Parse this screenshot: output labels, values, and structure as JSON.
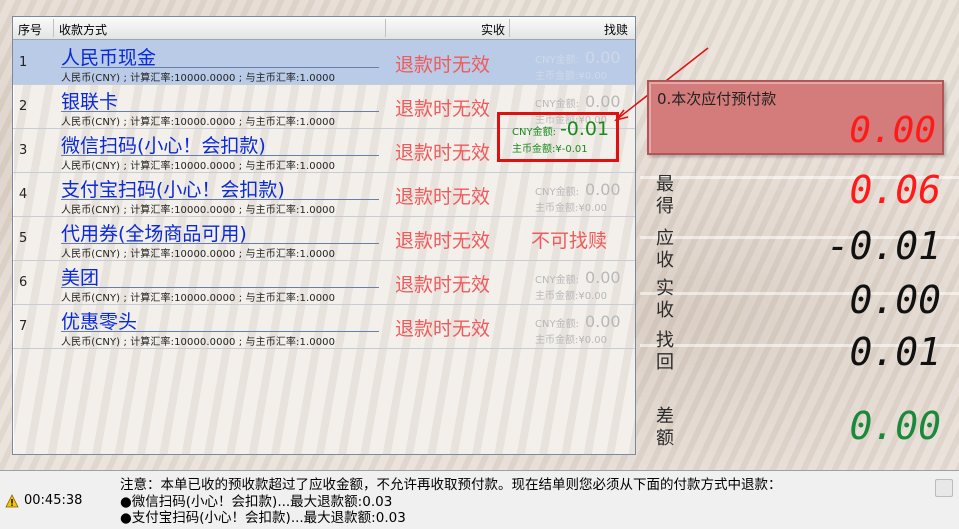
{
  "table": {
    "headers": {
      "index": "序号",
      "method": "收款方式",
      "received": "实收",
      "change": "找赎"
    },
    "rows": [
      {
        "index": "1",
        "name": "人民币现金",
        "sub": "人民币(CNY) ; 计算汇率:10000.0000 ; 与主币汇率:1.0000",
        "received": "退款时无效",
        "cny_label": "CNY金额:",
        "cny_value": "0.00",
        "main_label": "主币金额:",
        "main_value": "¥0.00"
      },
      {
        "index": "2",
        "name": "银联卡",
        "sub": "人民币(CNY) ; 计算汇率:10000.0000 ; 与主币汇率:1.0000",
        "received": "退款时无效",
        "cny_label": "CNY金额:",
        "cny_value": "0.00",
        "main_label": "主币金额:",
        "main_value": "¥0.00"
      },
      {
        "index": "3",
        "name": "微信扫码(小心！会扣款)",
        "sub": "人民币(CNY) ; 计算汇率:10000.0000 ; 与主币汇率:1.0000",
        "received": "退款时无效",
        "cny_label": "CNY金额:",
        "cny_value": "-0.01",
        "main_label": "主币金额:",
        "main_value": "¥-0.01"
      },
      {
        "index": "4",
        "name": "支付宝扫码(小心！会扣款)",
        "sub": "人民币(CNY) ; 计算汇率:10000.0000 ; 与主币汇率:1.0000",
        "received": "退款时无效",
        "cny_label": "CNY金额:",
        "cny_value": "0.00",
        "main_label": "主币金额:",
        "main_value": "¥0.00"
      },
      {
        "index": "5",
        "name": "代用券(全场商品可用)",
        "sub": "人民币(CNY) ; 计算汇率:10000.0000 ; 与主币汇率:1.0000",
        "received": "退款时无效",
        "no_change": "不可找赎"
      },
      {
        "index": "6",
        "name": "美团",
        "sub": "人民币(CNY) ; 计算汇率:10000.0000 ; 与主币汇率:1.0000",
        "received": "退款时无效",
        "cny_label": "CNY金额:",
        "cny_value": "0.00",
        "main_label": "主币金额:",
        "main_value": "¥0.00"
      },
      {
        "index": "7",
        "name": "优惠零头",
        "sub": "人民币(CNY) ; 计算汇率:10000.0000 ; 与主币汇率:1.0000",
        "received": "退款时无效",
        "cny_label": "CNY金额:",
        "cny_value": "0.00",
        "main_label": "主币金额:",
        "main_value": "¥0.00"
      }
    ]
  },
  "prepay": {
    "label": "0.本次应付预付款",
    "value": "0.00"
  },
  "stats": [
    {
      "label": "最得",
      "value": "0.06",
      "color": "#ff1a1a"
    },
    {
      "label": "应收",
      "value": "-0.01",
      "color": "#111111"
    },
    {
      "label": "实收",
      "value": "0.00",
      "color": "#111111"
    },
    {
      "label": "找回",
      "value": "0.01",
      "color": "#111111"
    },
    {
      "label": "差额",
      "value": "0.00",
      "color": "#1a8a3a"
    }
  ],
  "status": {
    "time": "00:45:38",
    "lines": [
      "注意：本单已收的预收款超过了应收金额，不允许再收取预付款。现在结单则您必须从下面的付款方式中退款：",
      "●微信扫码(小心！会扣款)...最大退款额:0.03",
      "●支付宝扫码(小心！会扣款)...最大退款额:0.03"
    ]
  },
  "colors": {
    "highlight": "#e01010",
    "link_blue": "#0a2ad8",
    "refund_red": "#f05a5a",
    "green": "#1a8a1a"
  }
}
